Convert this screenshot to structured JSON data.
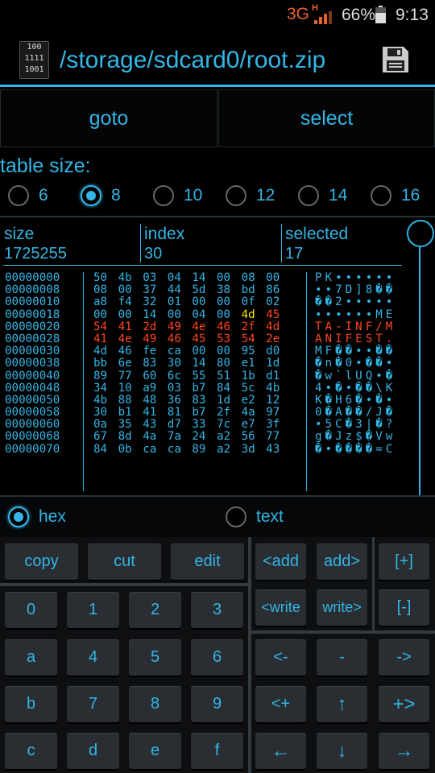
{
  "status_bar": {
    "network": "3G",
    "network_sub": "H",
    "battery_percent": "66%",
    "time": "9:13"
  },
  "action_bar": {
    "icon_lines": [
      "100",
      "1111",
      "1001"
    ],
    "title": "/storage/sdcard0/root.zip",
    "save_icon": "save-icon"
  },
  "buttons": {
    "goto": "goto",
    "select": "select"
  },
  "table_size": {
    "label": "table size:",
    "options": [
      "6",
      "8",
      "10",
      "12",
      "14",
      "16"
    ],
    "selected": "8"
  },
  "table_header": {
    "size_label": "size",
    "size_value": "1725255",
    "index_label": "index",
    "index_value": "30",
    "selected_label": "selected",
    "selected_value": "17"
  },
  "hex_rows": [
    {
      "addr": "00000000",
      "bytes": [
        "50",
        "4b",
        "03",
        "04",
        "14",
        "00",
        "08",
        "00"
      ],
      "ascii": "PK••••••"
    },
    {
      "addr": "00000008",
      "bytes": [
        "08",
        "00",
        "37",
        "44",
        "5d",
        "38",
        "bd",
        "86"
      ],
      "ascii": "••7D]8��"
    },
    {
      "addr": "00000010",
      "bytes": [
        "a8",
        "f4",
        "32",
        "01",
        "00",
        "00",
        "0f",
        "02"
      ],
      "ascii": "��2•••••"
    },
    {
      "addr": "00000018",
      "bytes": [
        "00",
        "00",
        "14",
        "00",
        "04",
        "00",
        "4d",
        "45"
      ],
      "ascii": "••••••ME"
    },
    {
      "addr": "00000020",
      "bytes": [
        "54",
        "41",
        "2d",
        "49",
        "4e",
        "46",
        "2f",
        "4d"
      ],
      "ascii": "TA-INF/M"
    },
    {
      "addr": "00000028",
      "bytes": [
        "41",
        "4e",
        "49",
        "46",
        "45",
        "53",
        "54",
        "2e"
      ],
      "ascii": "ANIFEST."
    },
    {
      "addr": "00000030",
      "bytes": [
        "4d",
        "46",
        "fe",
        "ca",
        "00",
        "00",
        "95",
        "d0"
      ],
      "ascii": "MF��••��"
    },
    {
      "addr": "00000038",
      "bytes": [
        "bb",
        "6e",
        "83",
        "30",
        "14",
        "80",
        "e1",
        "1d"
      ],
      "ascii": "�n�0•��•"
    },
    {
      "addr": "00000040",
      "bytes": [
        "89",
        "77",
        "60",
        "6c",
        "55",
        "51",
        "1b",
        "d1"
      ],
      "ascii": "�w`lUQ•�"
    },
    {
      "addr": "00000048",
      "bytes": [
        "34",
        "10",
        "a9",
        "03",
        "b7",
        "84",
        "5c",
        "4b"
      ],
      "ascii": "4•�•��\\K"
    },
    {
      "addr": "00000050",
      "bytes": [
        "4b",
        "88",
        "48",
        "36",
        "83",
        "1d",
        "e2",
        "12"
      ],
      "ascii": "K�H6�•�•"
    },
    {
      "addr": "00000058",
      "bytes": [
        "30",
        "b1",
        "41",
        "81",
        "b7",
        "2f",
        "4a",
        "97"
      ],
      "ascii": "0�A��/J�"
    },
    {
      "addr": "00000060",
      "bytes": [
        "0a",
        "35",
        "43",
        "d7",
        "33",
        "7c",
        "e7",
        "3f"
      ],
      "ascii": "•5C�3|�?"
    },
    {
      "addr": "00000068",
      "bytes": [
        "67",
        "8d",
        "4a",
        "7a",
        "24",
        "a2",
        "56",
        "77"
      ],
      "ascii": "g�Jz$�Vw"
    },
    {
      "addr": "00000070",
      "bytes": [
        "84",
        "0b",
        "ca",
        "ca",
        "89",
        "a2",
        "3d",
        "43"
      ],
      "ascii": "�•����=C"
    }
  ],
  "mode": {
    "hex_label": "hex",
    "text_label": "text",
    "selected": "hex"
  },
  "keypad": {
    "copy": "copy",
    "cut": "cut",
    "edit": "edit",
    "add_left": "<add",
    "add_right": "add>",
    "plus": "[+]",
    "write_left": "<write",
    "write_right": "write>",
    "minus": "[-]",
    "digits": [
      "0",
      "1",
      "2",
      "3",
      "a",
      "4",
      "5",
      "6",
      "b",
      "7",
      "8",
      "9",
      "c",
      "d",
      "e",
      "f"
    ],
    "nav": [
      "<-",
      "-",
      "->",
      "<+",
      "↑",
      "+>",
      "←",
      "↓",
      "→"
    ]
  },
  "colors": {
    "accent": "#33b5e5",
    "highlight_red": "#ff4422",
    "highlight_yellow": "#ffea00",
    "network": "#e8622a"
  }
}
